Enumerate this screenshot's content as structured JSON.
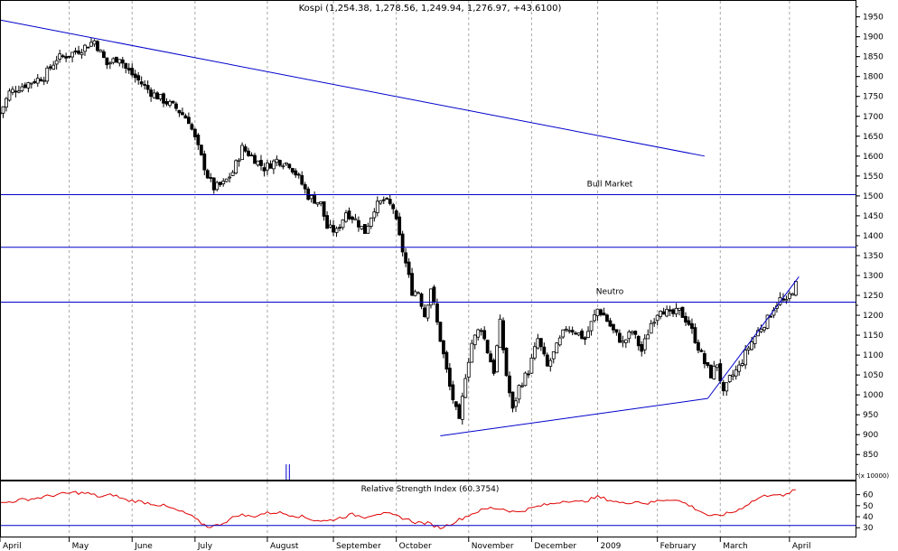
{
  "chart_data": {
    "type": "candlestick",
    "title": "Kospi (1,254.38, 1,278.56, 1,249.94, 1,276.97, +43.6100)",
    "price_axis": {
      "ylim": [
        787,
        1990
      ],
      "ticks": [
        850,
        900,
        950,
        1000,
        1050,
        1100,
        1150,
        1200,
        1250,
        1300,
        1350,
        1400,
        1450,
        1500,
        1550,
        1600,
        1650,
        1700,
        1750,
        1800,
        1850,
        1900,
        1950
      ],
      "position": "right"
    },
    "x_axis": {
      "months": [
        {
          "label": "April",
          "day": 0
        },
        {
          "label": "May",
          "day": 22
        },
        {
          "label": "June",
          "day": 42
        },
        {
          "label": "July",
          "day": 62
        },
        {
          "label": "August",
          "day": 85
        },
        {
          "label": "September",
          "day": 106
        },
        {
          "label": "October",
          "day": 126
        },
        {
          "label": "November",
          "day": 149
        },
        {
          "label": "December",
          "day": 169
        },
        {
          "label": "2009",
          "day": 190
        },
        {
          "label": "February",
          "day": 209
        },
        {
          "label": "March",
          "day": 229
        },
        {
          "label": "April",
          "day": 251
        }
      ],
      "day_range": [
        0,
        272
      ]
    },
    "anchor_closes": [
      [
        0,
        1708
      ],
      [
        3,
        1760
      ],
      [
        8,
        1780
      ],
      [
        14,
        1800
      ],
      [
        18,
        1845
      ],
      [
        22,
        1855
      ],
      [
        26,
        1870
      ],
      [
        30,
        1890
      ],
      [
        34,
        1830
      ],
      [
        38,
        1850
      ],
      [
        40,
        1820
      ],
      [
        44,
        1790
      ],
      [
        48,
        1760
      ],
      [
        52,
        1740
      ],
      [
        56,
        1720
      ],
      [
        60,
        1690
      ],
      [
        63,
        1620
      ],
      [
        66,
        1550
      ],
      [
        68,
        1520
      ],
      [
        71,
        1530
      ],
      [
        74,
        1560
      ],
      [
        77,
        1620
      ],
      [
        80,
        1600
      ],
      [
        84,
        1570
      ],
      [
        88,
        1590
      ],
      [
        92,
        1580
      ],
      [
        95,
        1545
      ],
      [
        98,
        1500
      ],
      [
        102,
        1480
      ],
      [
        104,
        1420
      ],
      [
        107,
        1410
      ],
      [
        110,
        1460
      ],
      [
        113,
        1440
      ],
      [
        116,
        1410
      ],
      [
        119,
        1470
      ],
      [
        122,
        1490
      ],
      [
        125,
        1470
      ],
      [
        127,
        1395
      ],
      [
        129,
        1330
      ],
      [
        131,
        1260
      ],
      [
        133,
        1260
      ],
      [
        135,
        1200
      ],
      [
        137,
        1270
      ],
      [
        139,
        1180
      ],
      [
        141,
        1100
      ],
      [
        143,
        1020
      ],
      [
        145,
        960
      ],
      [
        146,
        930
      ],
      [
        148,
        1050
      ],
      [
        150,
        1130
      ],
      [
        152,
        1160
      ],
      [
        153,
        1170
      ],
      [
        155,
        1110
      ],
      [
        157,
        1060
      ],
      [
        159,
        1180
      ],
      [
        161,
        1050
      ],
      [
        163,
        960
      ],
      [
        165,
        1020
      ],
      [
        168,
        1060
      ],
      [
        171,
        1140
      ],
      [
        174,
        1070
      ],
      [
        177,
        1120
      ],
      [
        180,
        1170
      ],
      [
        183,
        1160
      ],
      [
        186,
        1140
      ],
      [
        188,
        1180
      ],
      [
        190,
        1215
      ],
      [
        192,
        1200
      ],
      [
        195,
        1160
      ],
      [
        198,
        1130
      ],
      [
        201,
        1160
      ],
      [
        204,
        1110
      ],
      [
        207,
        1180
      ],
      [
        210,
        1220
      ],
      [
        213,
        1200
      ],
      [
        216,
        1210
      ],
      [
        219,
        1180
      ],
      [
        222,
        1120
      ],
      [
        224,
        1080
      ],
      [
        226,
        1050
      ],
      [
        228,
        1080
      ],
      [
        230,
        1000
      ],
      [
        232,
        1040
      ],
      [
        235,
        1070
      ],
      [
        238,
        1120
      ],
      [
        241,
        1160
      ],
      [
        244,
        1190
      ],
      [
        246,
        1220
      ],
      [
        248,
        1240
      ],
      [
        250,
        1230
      ],
      [
        251,
        1250
      ],
      [
        253,
        1277
      ]
    ],
    "horizontal_lines": [
      {
        "value": 1503,
        "label": "Bull Market"
      },
      {
        "value": 1371,
        "label": ""
      },
      {
        "value": 1233,
        "label": "Neutro"
      }
    ],
    "trendlines": [
      {
        "from": [
          0,
          1942
        ],
        "to": [
          224,
          1600
        ]
      },
      {
        "from": [
          140,
          897
        ],
        "to": [
          225,
          991
        ]
      },
      {
        "from": [
          225,
          991
        ],
        "to": [
          254,
          1297
        ]
      }
    ],
    "volume_marks": [
      {
        "day": 91
      },
      {
        "day": 92
      }
    ],
    "rsi": {
      "title": "Relative Strength Index (60.3754)",
      "ylim": [
        22,
        72
      ],
      "ticks": [
        30,
        40,
        50,
        60
      ],
      "reference_line": 32,
      "anchors": [
        [
          0,
          52
        ],
        [
          6,
          55
        ],
        [
          12,
          57
        ],
        [
          18,
          60
        ],
        [
          24,
          62
        ],
        [
          28,
          61
        ],
        [
          32,
          58
        ],
        [
          36,
          60
        ],
        [
          40,
          55
        ],
        [
          44,
          54
        ],
        [
          48,
          52
        ],
        [
          52,
          50
        ],
        [
          56,
          46
        ],
        [
          60,
          42
        ],
        [
          63,
          36
        ],
        [
          66,
          31
        ],
        [
          69,
          32
        ],
        [
          72,
          36
        ],
        [
          76,
          42
        ],
        [
          80,
          40
        ],
        [
          84,
          43
        ],
        [
          88,
          44
        ],
        [
          92,
          42
        ],
        [
          96,
          40
        ],
        [
          100,
          37
        ],
        [
          104,
          36
        ],
        [
          108,
          39
        ],
        [
          112,
          42
        ],
        [
          116,
          40
        ],
        [
          120,
          43
        ],
        [
          124,
          42
        ],
        [
          128,
          39
        ],
        [
          132,
          35
        ],
        [
          136,
          34
        ],
        [
          140,
          30
        ],
        [
          142,
          32
        ],
        [
          145,
          36
        ],
        [
          148,
          40
        ],
        [
          152,
          45
        ],
        [
          156,
          48
        ],
        [
          160,
          47
        ],
        [
          164,
          44
        ],
        [
          168,
          47
        ],
        [
          172,
          50
        ],
        [
          176,
          52
        ],
        [
          180,
          55
        ],
        [
          184,
          53
        ],
        [
          188,
          56
        ],
        [
          190,
          58
        ],
        [
          194,
          55
        ],
        [
          198,
          52
        ],
        [
          202,
          54
        ],
        [
          206,
          52
        ],
        [
          210,
          55
        ],
        [
          214,
          56
        ],
        [
          218,
          52
        ],
        [
          222,
          46
        ],
        [
          226,
          40
        ],
        [
          230,
          42
        ],
        [
          234,
          45
        ],
        [
          238,
          52
        ],
        [
          242,
          58
        ],
        [
          246,
          61
        ],
        [
          249,
          58
        ],
        [
          251,
          62
        ],
        [
          253,
          64
        ]
      ]
    },
    "scale_note": "(x 10000)",
    "colors": {
      "trend": "#0000cc",
      "rsi": "#e00000",
      "grid": "#a8a8a8"
    }
  }
}
